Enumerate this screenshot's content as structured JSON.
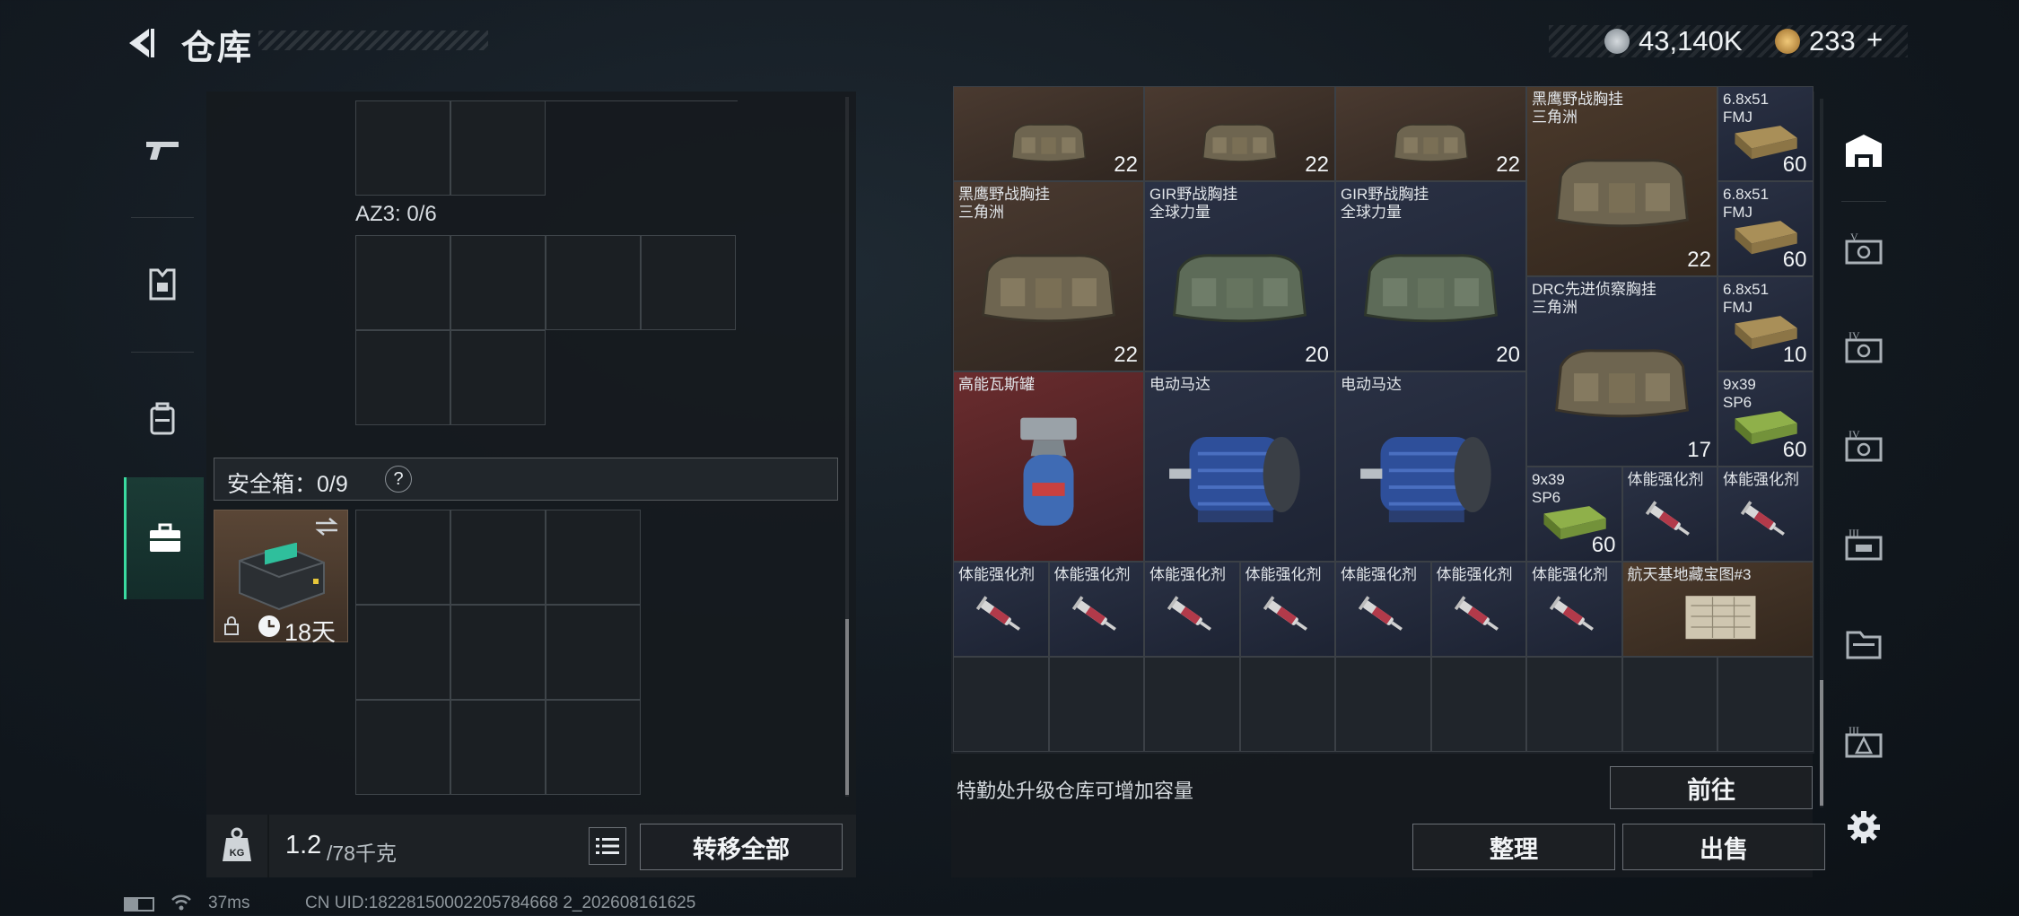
{
  "header": {
    "back_icon": "back-arrow-icon",
    "title": "仓库",
    "currency_silver": "43,140K",
    "currency_gold": "233",
    "currency_add": "+",
    "silver_icon": "silver-coin-icon",
    "gold_icon": "gold-coin-icon",
    "colors": {
      "accent": "#3adba0",
      "silver": "#9aa3aa",
      "gold": "#c89a4a"
    }
  },
  "left_nav": [
    {
      "icon": "pistol-icon",
      "active": false
    },
    {
      "icon": "armor-vest-icon",
      "active": false
    },
    {
      "icon": "backpack-icon",
      "active": false
    },
    {
      "icon": "briefcase-icon",
      "active": true
    }
  ],
  "left_panel": {
    "az3_label": "AZ3: 0/6",
    "safebox_label": "安全箱：0/9",
    "safebox_help": "?",
    "safebox_item_timer": "18天",
    "safebox_item_lock_icon": "lock-icon",
    "safebox_item_clock_icon": "clock-icon",
    "safebox_item_swap_icon": "swap-icon",
    "weight_current": "1.2",
    "weight_max": "/78千克",
    "weight_icon": "weight-kg-icon",
    "list_icon": "list-icon",
    "transfer_all_label": "转移全部"
  },
  "right_panel": {
    "items": [
      {
        "label": "",
        "count": "22",
        "bg": "tan"
      },
      {
        "label": "",
        "count": "22",
        "bg": "tan"
      },
      {
        "label": "",
        "count": "22",
        "bg": "tan"
      },
      {
        "label": "黑鹰野战胸挂\n三角洲",
        "count": "22",
        "bg": "brown"
      },
      {
        "label": "6.8x51\nFMJ",
        "count": "60",
        "bg": "navy"
      },
      {
        "label": "黑鹰野战胸挂\n三角洲",
        "count": "22",
        "bg": "tan"
      },
      {
        "label": "GIR野战胸挂\n全球力量",
        "count": "20",
        "bg": "navy"
      },
      {
        "label": "GIR野战胸挂\n全球力量",
        "count": "20",
        "bg": "navy"
      },
      {
        "label": "6.8x51\nFMJ",
        "count": "60",
        "bg": "navy"
      },
      {
        "label": "DRC先进侦察胸挂\n三角洲",
        "count": "17",
        "bg": "navy"
      },
      {
        "label": "6.8x51\nFMJ",
        "count": "10",
        "bg": "navy"
      },
      {
        "label": "高能瓦斯罐",
        "count": "",
        "bg": "red"
      },
      {
        "label": "电动马达",
        "count": "",
        "bg": "navy"
      },
      {
        "label": "电动马达",
        "count": "",
        "bg": "navy"
      },
      {
        "label": "9x39\nSP6",
        "count": "60",
        "bg": "navy"
      },
      {
        "label": "9x39\nSP6",
        "count": "60",
        "bg": "navy"
      },
      {
        "label": "体能强化剂",
        "count": "",
        "bg": "navy"
      },
      {
        "label": "体能强化剂",
        "count": "",
        "bg": "navy"
      },
      {
        "label": "体能强化剂",
        "count": "",
        "bg": "navy"
      },
      {
        "label": "体能强化剂",
        "count": "",
        "bg": "navy"
      },
      {
        "label": "体能强化剂",
        "count": "",
        "bg": "navy"
      },
      {
        "label": "体能强化剂",
        "count": "",
        "bg": "navy"
      },
      {
        "label": "体能强化剂",
        "count": "",
        "bg": "navy"
      },
      {
        "label": "体能强化剂",
        "count": "",
        "bg": "navy"
      },
      {
        "label": "体能强化剂",
        "count": "",
        "bg": "navy"
      },
      {
        "label": "航天基地藏宝图#3",
        "count": "",
        "bg": "brown"
      }
    ],
    "upgrade_hint": "特勤处升级仓库可增加容量",
    "goto_label": "前往",
    "organize_label": "整理",
    "sell_label": "出售"
  },
  "right_nav": [
    {
      "icon": "storage-home-icon",
      "active": true
    },
    {
      "icon": "tier-5-case-icon"
    },
    {
      "icon": "tier-4-case-icon"
    },
    {
      "icon": "tier-4-case-icon"
    },
    {
      "icon": "tier-3-case-icon"
    },
    {
      "icon": "folder-icon"
    },
    {
      "icon": "tier-3-case-icon"
    },
    {
      "icon": "settings-gear-icon"
    }
  ],
  "footer": {
    "ping": "37ms",
    "uid": "CN UID:18228150002205784668 2_202608161625"
  }
}
